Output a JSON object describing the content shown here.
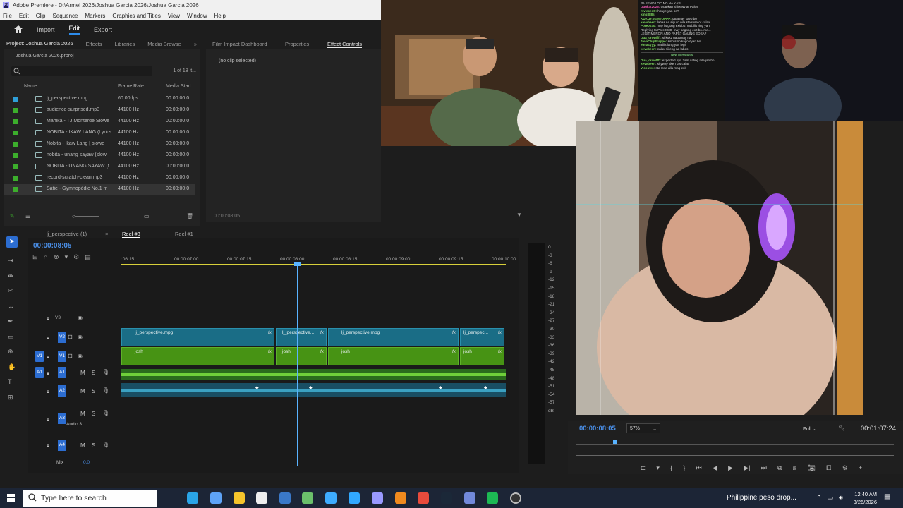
{
  "app": {
    "title": "Adobe Premiere - D:\\Armel 2026\\Joshua Garcia 2026\\Joshua Garcia 2026"
  },
  "menu": [
    "File",
    "Edit",
    "Clip",
    "Sequence",
    "Markers",
    "Graphics and Titles",
    "View",
    "Window",
    "Help"
  ],
  "workspace": {
    "home_icon": "home-icon",
    "tabs": [
      "Import",
      "Edit",
      "Export"
    ],
    "active": "Edit"
  },
  "project": {
    "tabs": [
      "Project: Joshua Garcia 2026",
      "Effects",
      "Libraries",
      "Media Browse"
    ],
    "file": "Joshua Garcia 2026.prproj",
    "search_placeholder": "",
    "item_count": "1 of 18 it...",
    "columns": {
      "name": "Name",
      "frame_rate": "Frame Rate",
      "media_start": "Media Start"
    },
    "items": [
      {
        "name": "lj_perspective.mpg",
        "rate": "60.00 fps",
        "start": "00:00:00:0",
        "color": "#2f9fd8"
      },
      {
        "name": "audience-surprised.mp3",
        "rate": "44100 Hz",
        "start": "00:00:00;0",
        "color": "#3cae2c"
      },
      {
        "name": "Mahika - TJ Monterde  Slowe",
        "rate": "44100 Hz",
        "start": "00:00:00;0",
        "color": "#3cae2c"
      },
      {
        "name": "NOBITA - IKAW LANG (Lyrics",
        "rate": "44100 Hz",
        "start": "00:00:00;0",
        "color": "#3cae2c"
      },
      {
        "name": "Nobita - Ikaw Lang [ slowe",
        "rate": "44100 Hz",
        "start": "00:00:00;0",
        "color": "#3cae2c"
      },
      {
        "name": "nobita - unang sayaw (slow",
        "rate": "44100 Hz",
        "start": "00:00:00;0",
        "color": "#3cae2c"
      },
      {
        "name": "NOBITA - UNANG SAYAW (f",
        "rate": "44100 Hz",
        "start": "00:00:00;0",
        "color": "#3cae2c"
      },
      {
        "name": "record-scratch-clean.mp3",
        "rate": "44100 Hz",
        "start": "00:00:00;0",
        "color": "#3cae2c"
      },
      {
        "name": "Satie - Gymnopédie No.1 m",
        "rate": "44100 Hz",
        "start": "00:00:00;0",
        "color": "#3cae2c"
      }
    ]
  },
  "effect_panel": {
    "tabs": [
      "Film Impact Dashboard",
      "Properties",
      "Effect Controls"
    ],
    "active": "Effect Controls",
    "no_clip": "(no clip selected)",
    "timecode": "00:00:08:05"
  },
  "timeline": {
    "tabs": [
      "lj_perspective (1)",
      "Reel #3",
      "Reel #1"
    ],
    "active": "Reel #3",
    "playhead_tc": "00:00:08:05",
    "ruler": [
      ":06:15",
      "00:00:07:00",
      "00:00:07:15",
      "00:00:08:00",
      "00:00:08:15",
      "00:00:09:00",
      "00:00:09:15",
      "00:00:10:00"
    ],
    "tracks": {
      "v3": "V3",
      "v2": "V2",
      "v1": "V1",
      "a1": "A1",
      "a2": "A2",
      "a3": "A3",
      "a4": "A4",
      "v1_src": "V1",
      "a1_src": "A1",
      "audio3_name": "Audio 3",
      "mix": "Mix",
      "mix_val": "0.0"
    },
    "v2_clips": [
      "lj_perspective.mpg",
      "lj_perspective...",
      "lj_perspective.mpg",
      "lj_perspec..."
    ],
    "v1_clips": [
      "josh",
      "josh",
      "josh",
      "josh"
    ],
    "fx": "fx"
  },
  "meter_scale": [
    "0",
    "-3",
    "-6",
    "-9",
    "-12",
    "-15",
    "-18",
    "-21",
    "-24",
    "-27",
    "-30",
    "-33",
    "-36",
    "-39",
    "-42",
    "-45",
    "-48",
    "-51",
    "-54",
    "-57",
    "dB"
  ],
  "program": {
    "timecode": "00:00:08:05",
    "zoom": "57%",
    "quality": "Full",
    "duration": "00:01:07:24"
  },
  "chat": [
    {
      "u": "",
      "m": "PA SEND LOC NO NA KASI",
      "c": "u"
    },
    {
      "u": "Dugkat2026:",
      "m": "usapkan si joewy at Palos",
      "c": "u2"
    },
    {
      "u": "mviecentt:",
      "m": "hiraye yan bo?",
      "c": "u"
    },
    {
      "u": "king888s:",
      "m": "",
      "c": "u"
    },
    {
      "u": "KUKUYSGMTOPPP:",
      "m": "tagaytay kayo bo",
      "c": "u"
    },
    {
      "u": "kevvbeen:",
      "m": "labas na siguro nila sta rosa or calax",
      "c": "u"
    },
    {
      "u": "Pore0030:",
      "m": "may bagong exit bo. mabilis ring yan",
      "c": "u"
    },
    {
      "u": "",
      "m": "Replying to Pore0030: may bagong exit bo. ma...",
      "c": "m"
    },
    {
      "u": "",
      "m": "LEGIT MERON ANO PAPS? GALING EDSA?",
      "c": "u"
    },
    {
      "u": "Dua_crowffff:",
      "m": "si kokz nauumay na.",
      "c": "u"
    },
    {
      "u": "JavaChipFrappe:",
      "m": "sino sino kayo dyan bo",
      "c": "u"
    },
    {
      "u": "elmacyyy:",
      "m": "matilis lang yan legit",
      "c": "u"
    },
    {
      "u": "kevvbeen:",
      "m": "calax siileng na labas",
      "c": "u"
    },
    {
      "u": "",
      "m": "New messages",
      "c": "nm"
    },
    {
      "u": "Dua_crowffff:",
      "m": "expected nyo 2am dating nila jan bo",
      "c": "u"
    },
    {
      "u": "kevvbeen:",
      "m": "skyway sken tas calax",
      "c": "u"
    },
    {
      "u": "Vicouws:",
      "m": "sta rosa alla mag exit",
      "c": "u"
    }
  ],
  "taskbar": {
    "search": "Type here to search",
    "news": "Philippine peso drop...",
    "time": "12:40 AM",
    "date": "3/26/2026",
    "icons": [
      "windows-icon",
      "task-view-icon",
      "edge-icon",
      "copilot-icon",
      "file-explorer-icon",
      "store-icon",
      "app-icon",
      "photos-icon",
      "photoshop-icon",
      "premiere-icon",
      "vlc-icon",
      "chrome-icon",
      "steam-icon",
      "discord-icon",
      "spotify-icon",
      "obs-icon"
    ]
  }
}
